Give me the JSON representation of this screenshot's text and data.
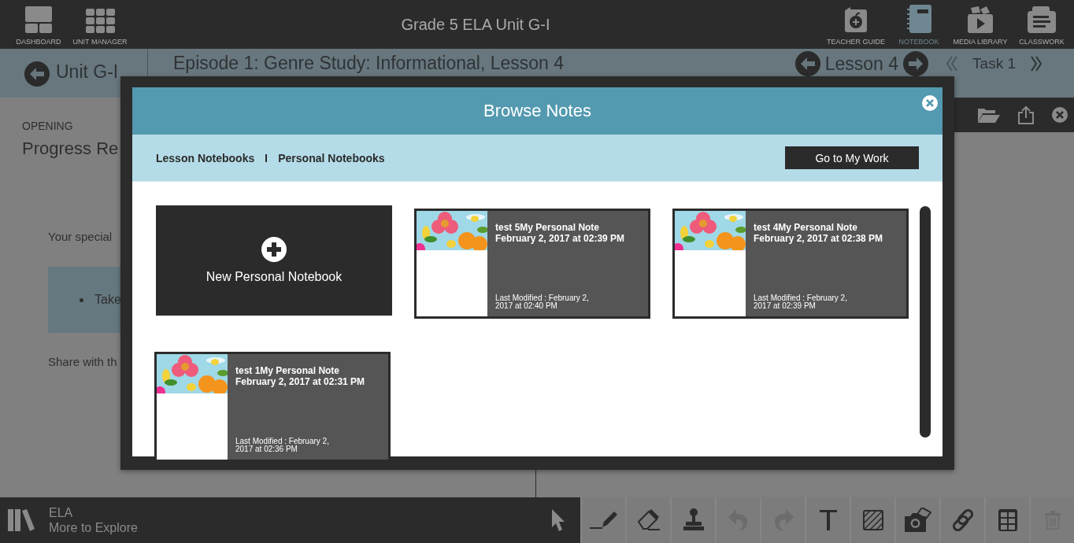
{
  "top_bar": {
    "title": "Grade 5 ELA Unit G-I",
    "left_items": [
      {
        "kind": "dashboard",
        "label": "DASHBOARD",
        "selected": false
      },
      {
        "kind": "grid",
        "label": "UNIT MANAGER",
        "selected": false
      }
    ],
    "right_items": [
      {
        "kind": "guide",
        "label": "TEACHER GUIDE",
        "selected": false
      },
      {
        "kind": "notebook",
        "label": "NOTEBOOK",
        "selected": true
      },
      {
        "kind": "media",
        "label": "MEDIA LIBRARY",
        "selected": false
      },
      {
        "kind": "classwork",
        "label": "CLASSWORK",
        "selected": false
      }
    ]
  },
  "nav_bar": {
    "unit": "Unit G-I",
    "episode": "Episode 1: Genre Study: Informational, Lesson 4",
    "lesson": "Lesson 4",
    "task": "Task 1"
  },
  "lesson": {
    "section": "OPENING",
    "heading": "Progress Re",
    "paragraph": "Your special",
    "bullets": [
      "Take"
    ],
    "closing": "Share with th"
  },
  "modal": {
    "title": "Browse Notes",
    "tabs": [
      "Lesson Notebooks",
      "Personal Notebooks"
    ],
    "action": "Go to My Work",
    "new_notebook": "New Personal Notebook",
    "notes": [
      {
        "title": "test 5My Personal Note",
        "created": "February 2, 2017 at 02:39 PM",
        "modified": "Last Modified : February 2, 2017 at 02:40 PM"
      },
      {
        "title": "test 4My Personal Note",
        "created": "February 2, 2017 at 02:38 PM",
        "modified": "Last Modified : February 2, 2017 at 02:39 PM"
      },
      {
        "title": "test 1My Personal Note",
        "created": "February 2, 2017 at 02:31 PM",
        "modified": "Last Modified : February 2, 2017 at 02:36 PM"
      }
    ]
  },
  "bottom_bar": {
    "subject": "ELA",
    "link": "More to Explore",
    "tools": [
      {
        "kind": "pointer",
        "selected": true,
        "disabled": false
      },
      {
        "kind": "pen",
        "selected": false,
        "disabled": false
      },
      {
        "kind": "eraser",
        "selected": false,
        "disabled": false
      },
      {
        "kind": "stamp",
        "selected": false,
        "disabled": false
      },
      {
        "kind": "undo",
        "selected": false,
        "disabled": true
      },
      {
        "kind": "redo",
        "selected": false,
        "disabled": true
      },
      {
        "kind": "text",
        "selected": false,
        "disabled": false
      },
      {
        "kind": "hatch",
        "selected": false,
        "disabled": false
      },
      {
        "kind": "camera",
        "selected": false,
        "disabled": false
      },
      {
        "kind": "link",
        "selected": false,
        "disabled": false
      },
      {
        "kind": "table",
        "selected": false,
        "disabled": false
      },
      {
        "kind": "trash",
        "selected": false,
        "disabled": true
      }
    ]
  }
}
